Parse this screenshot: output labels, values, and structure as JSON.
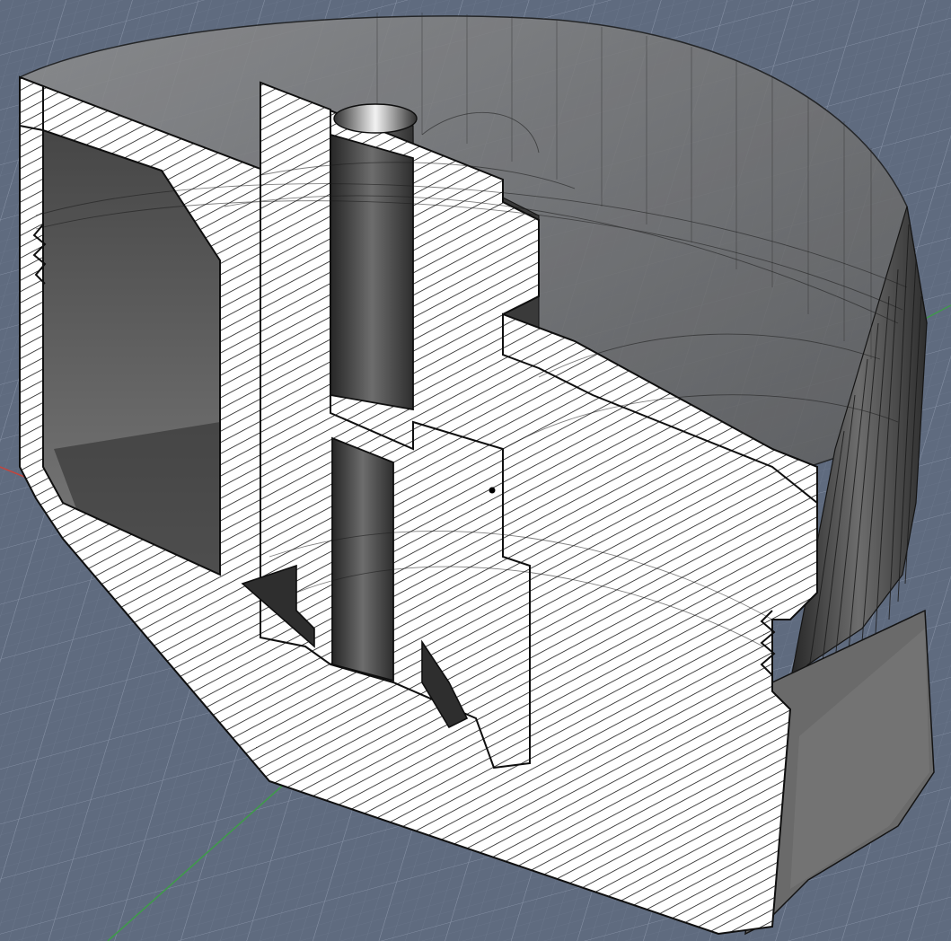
{
  "scene": {
    "view": "section-view",
    "model": "cap-cross-section",
    "palette": {
      "background": "#5f6b7f",
      "grid_minor": "#7f8aa0",
      "grid_major": "#98a2b5",
      "axis_red": "#c0463f",
      "axis_green": "#3f9a4a",
      "section_fill": "#ffffff",
      "hatch": "#0b0b0b",
      "outline": "#101010",
      "body_dark": "#3a3a3a",
      "body_mid": "#5e5e5e",
      "body_light": "#8a8a8a",
      "top_rim": "#727272"
    },
    "features": {
      "section_hatch": "diagonal",
      "grid": true,
      "transparency": true,
      "knurled_rim": true,
      "threads": 2
    }
  }
}
